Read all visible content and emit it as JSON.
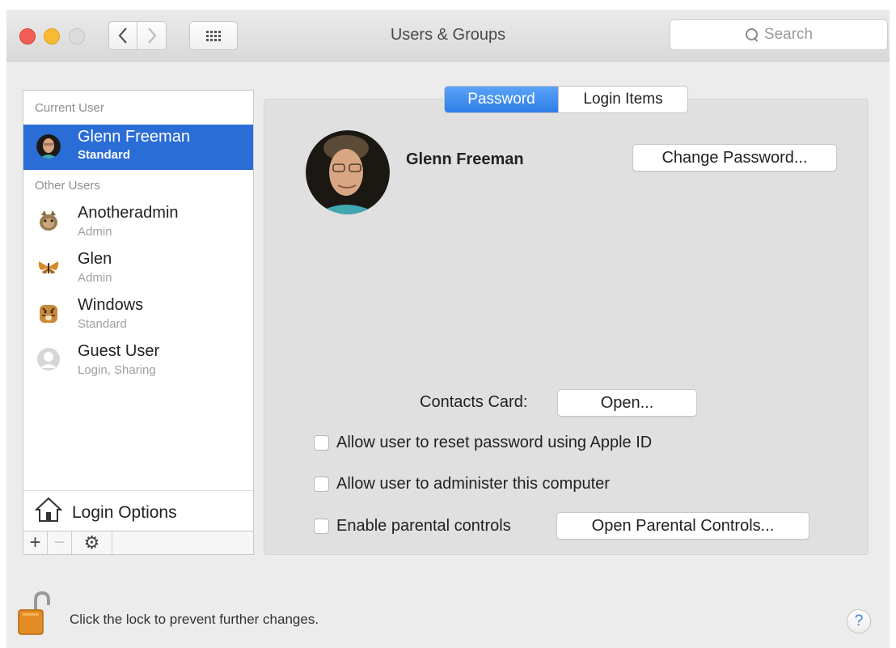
{
  "window": {
    "title": "Users & Groups",
    "search_placeholder": "Search"
  },
  "sidebar": {
    "current_user_header": "Current User",
    "other_users_header": "Other Users",
    "current_user": {
      "name": "Glenn Freeman",
      "role": "Standard"
    },
    "other_users": [
      {
        "name": "Anotheradmin",
        "role": "Admin",
        "icon": "cat-avatar-icon"
      },
      {
        "name": "Glen",
        "role": "Admin",
        "icon": "butterfly-avatar-icon"
      },
      {
        "name": "Windows",
        "role": "Standard",
        "icon": "tiger-avatar-icon"
      },
      {
        "name": "Guest User",
        "role": "Login, Sharing",
        "icon": "guest-avatar-icon"
      }
    ],
    "login_options_label": "Login Options",
    "toolbar": {
      "add": "+",
      "remove": "−",
      "gear": "⚙"
    }
  },
  "main": {
    "tabs": [
      {
        "label": "Password",
        "active": true
      },
      {
        "label": "Login Items",
        "active": false
      }
    ],
    "user_name": "Glenn Freeman",
    "change_password_label": "Change Password...",
    "contacts_card_label": "Contacts Card:",
    "open_label": "Open...",
    "checkboxes": [
      {
        "label": "Allow user to reset password using Apple ID",
        "checked": false
      },
      {
        "label": "Allow user to administer this computer",
        "checked": false
      },
      {
        "label": "Enable parental controls",
        "checked": false
      }
    ],
    "open_parental_label": "Open Parental Controls..."
  },
  "footer": {
    "lock_text": "Click the lock to prevent further changes.",
    "help_label": "?"
  },
  "colors": {
    "selection": "#2b6dd6",
    "tab_active": "#2f7de8",
    "close": "#f25d55",
    "minimize": "#f6bb33"
  }
}
